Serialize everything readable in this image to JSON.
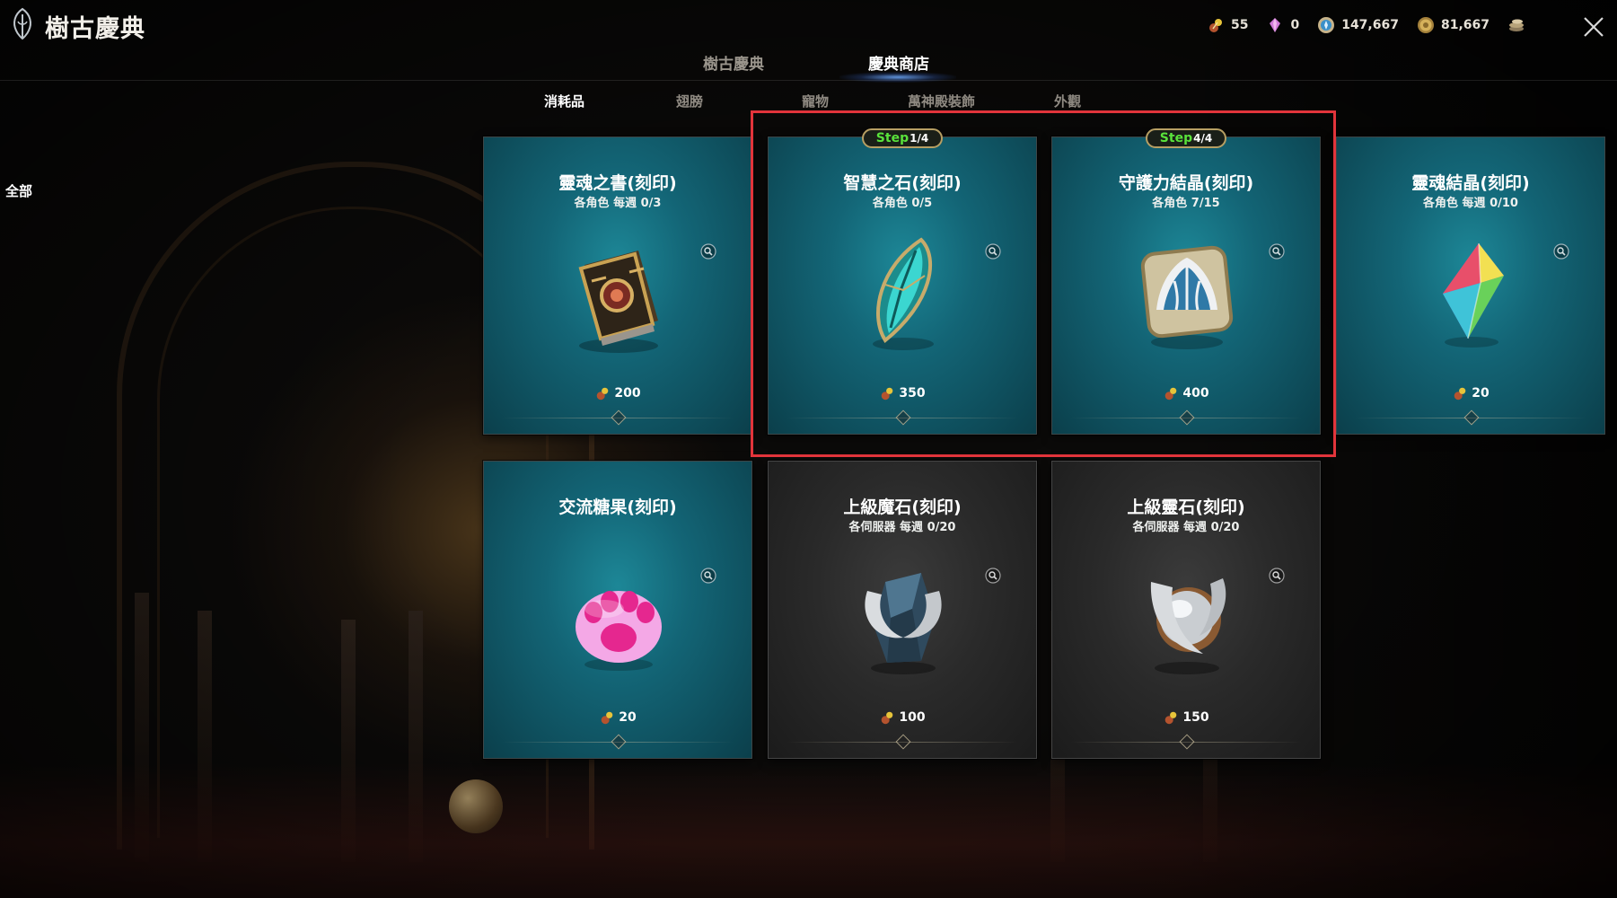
{
  "header": {
    "title": "樹古慶典",
    "currencies": [
      {
        "icon": "festival-token-icon",
        "value": "55"
      },
      {
        "icon": "pink-gem-icon",
        "value": "0"
      },
      {
        "icon": "blue-orb-coin-icon",
        "value": "147,667"
      },
      {
        "icon": "gold-coin-icon",
        "value": "81,667"
      },
      {
        "icon": "stack-coin-icon",
        "value": ""
      }
    ]
  },
  "main_tabs": [
    {
      "label": "樹古慶典",
      "active": false
    },
    {
      "label": "慶典商店",
      "active": true
    }
  ],
  "sub_tabs": [
    {
      "label": "消耗品",
      "active": true
    },
    {
      "label": "翅膀",
      "active": false
    },
    {
      "label": "寵物",
      "active": false
    },
    {
      "label": "萬神殿裝飾",
      "active": false
    },
    {
      "label": "外觀",
      "active": false
    }
  ],
  "side_filter": {
    "label": "全部"
  },
  "colors": {
    "highlight": "#e2343b",
    "step_green": "#59e23b",
    "teal_card": "#136576",
    "dark_card": "#2a2a2a"
  },
  "items": [
    {
      "name": "靈魂之書(刻印)",
      "limit": "各角色 每週 0/3",
      "price": "200",
      "style": "teal",
      "icon": "soul-book-icon",
      "step": null
    },
    {
      "name": "智慧之石(刻印)",
      "limit": "各角色  0/5",
      "price": "350",
      "style": "teal",
      "icon": "wisdom-stone-icon",
      "step": {
        "label": "Step",
        "value": "1/4"
      }
    },
    {
      "name": "守護力結晶(刻印)",
      "limit": "各角色  7/15",
      "price": "400",
      "style": "teal",
      "icon": "guardian-crystal-icon",
      "step": {
        "label": "Step",
        "value": "4/4"
      }
    },
    {
      "name": "靈魂結晶(刻印)",
      "limit": "各角色 每週 0/10",
      "price": "20",
      "style": "teal",
      "icon": "soul-crystal-icon",
      "step": null
    },
    {
      "name": "交流糖果(刻印)",
      "limit": "",
      "price": "20",
      "style": "teal",
      "icon": "paw-candy-icon",
      "step": null
    },
    {
      "name": "上級魔石(刻印)",
      "limit": "各伺服器 每週 0/20",
      "price": "100",
      "style": "dark",
      "icon": "magic-stone-icon",
      "step": null
    },
    {
      "name": "上級靈石(刻印)",
      "limit": "各伺服器 每週 0/20",
      "price": "150",
      "style": "dark",
      "icon": "spirit-stone-icon",
      "step": null
    }
  ]
}
